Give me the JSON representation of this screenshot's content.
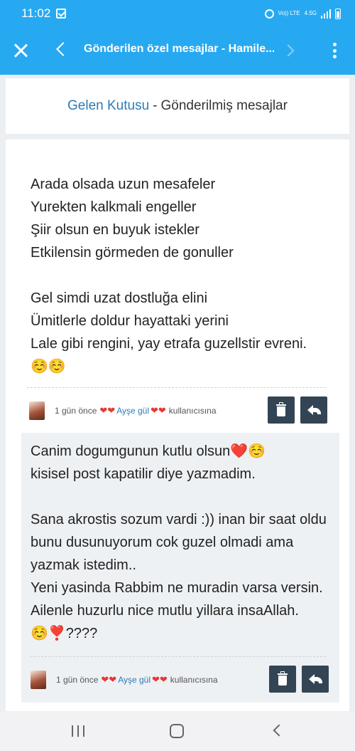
{
  "status_bar": {
    "time": "11:02",
    "network_label": "Vo)) LTE",
    "network_speed": "4.5G"
  },
  "app_bar": {
    "title": "Gönderilen özel mesajlar - Hamile..."
  },
  "folder_header": {
    "inbox_link": "Gelen Kutusu",
    "separator": "-",
    "current_folder": "Gönderilmiş mesajlar"
  },
  "messages": [
    {
      "text": "Arada olsada uzun mesafeler\nYurekten kalkmali engeller\nŞiir olsun en buyuk istekler\nEtkilensin görmeden de gonuller\n\nGel simdi uzat dostluğa elini\nÜmitlerle doldur hayattaki yerini\nLale gibi rengini, yay etrafa guzellstir evreni.\n☺️☺️",
      "time_ago": "1 gün önce",
      "recipient": "Ayşe gül",
      "recipient_suffix": "kullanıcısına",
      "heart": "❤❤"
    },
    {
      "text": "Canim dogumgunun kutlu olsun❤️☺️\nkisisel post kapatilir diye yazmadim.\n\nSana akrostis sozum vardi :)) inan bir saat oldu bunu dusunuyorum cok guzel olmadi ama yazmak istedim..\nYeni yasinda Rabbim ne muradin varsa versin. Ailenle huzurlu nice mutlu yillara insaAllah.☺️❣️????",
      "time_ago": "1 gün önce",
      "recipient": "Ayşe gül",
      "recipient_suffix": "kullanıcısına",
      "heart": "❤❤"
    }
  ],
  "colors": {
    "app_bar": "#27a9f1",
    "link": "#2d7bb5",
    "action_button": "#334455",
    "heart": "#e53935"
  }
}
